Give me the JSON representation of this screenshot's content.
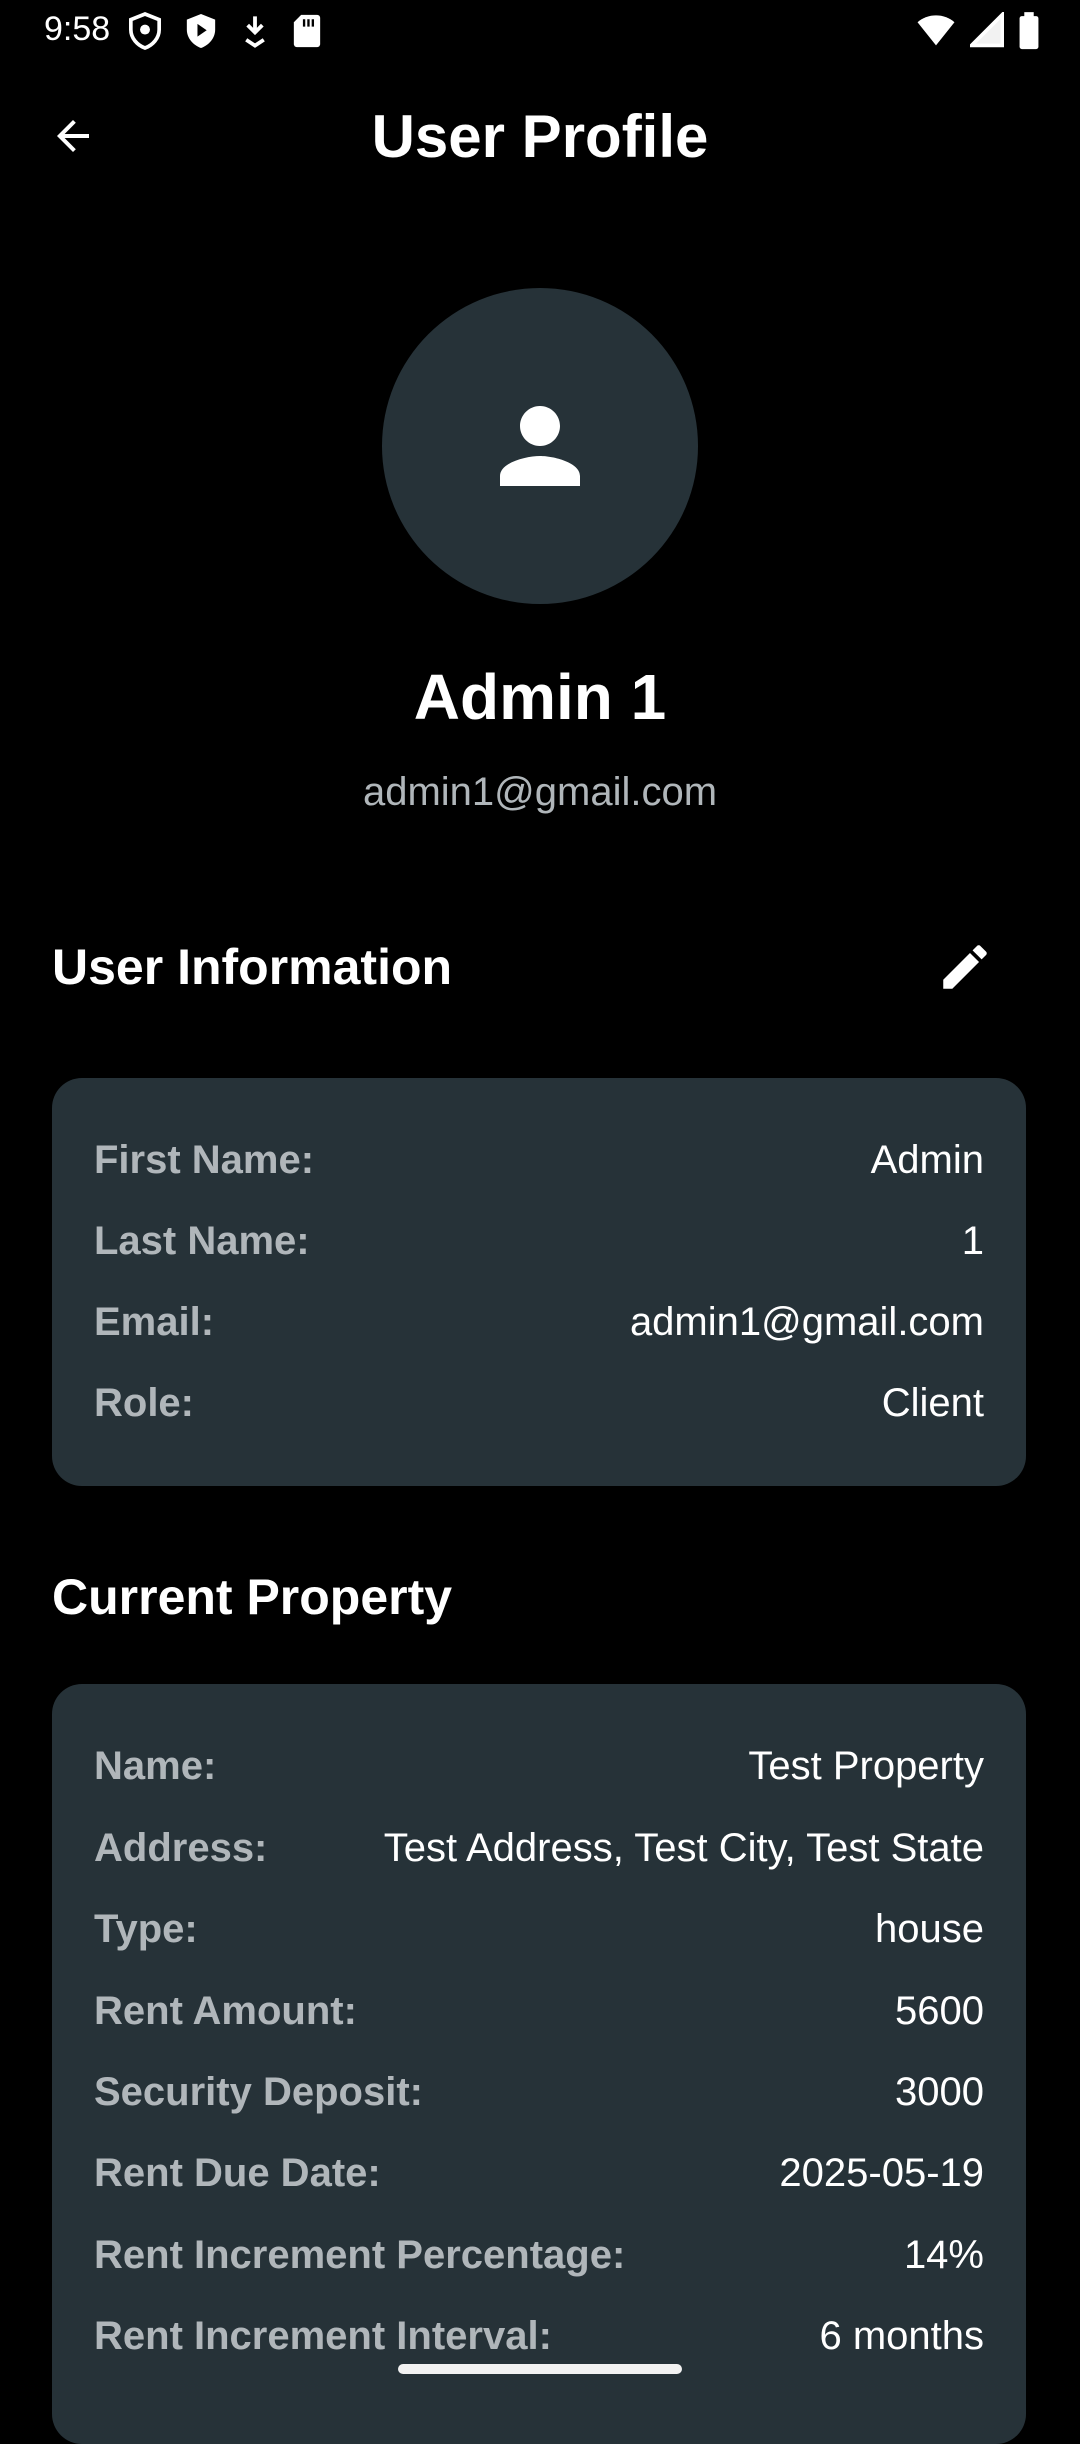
{
  "status_bar": {
    "time": "9:58",
    "left_icons": [
      "shield-icon",
      "play-protect-icon",
      "download-icon",
      "sd-card-icon"
    ],
    "right_icons": [
      "wifi-icon",
      "signal-icon",
      "battery-icon"
    ]
  },
  "app_bar": {
    "title": "User Profile",
    "back_icon": "arrow-back-icon"
  },
  "profile": {
    "avatar_icon": "person-icon",
    "name": "Admin 1",
    "email": "admin1@gmail.com"
  },
  "user_information": {
    "title": "User Information",
    "edit_icon": "pencil-icon",
    "rows": [
      {
        "label": "First Name:",
        "value": "Admin"
      },
      {
        "label": "Last Name:",
        "value": "1"
      },
      {
        "label": "Email:",
        "value": "admin1@gmail.com"
      },
      {
        "label": "Role:",
        "value": "Client"
      }
    ]
  },
  "current_property": {
    "title": "Current Property",
    "rows": [
      {
        "label": "Name:",
        "value": "Test Property"
      },
      {
        "label": "Address:",
        "value": "Test Address, Test City, Test State"
      },
      {
        "label": "Type:",
        "value": "house"
      },
      {
        "label": "Rent Amount:",
        "value": "5600"
      },
      {
        "label": "Security Deposit:",
        "value": "3000"
      },
      {
        "label": "Rent Due Date:",
        "value": "2025-05-19"
      },
      {
        "label": "Rent Increment Percentage:",
        "value": "14%"
      },
      {
        "label": "Rent Increment Interval:",
        "value": "6 months"
      }
    ]
  },
  "colors": {
    "background": "#000000",
    "card": "#263238",
    "label": "#b0b6ba",
    "text": "#ffffff"
  }
}
